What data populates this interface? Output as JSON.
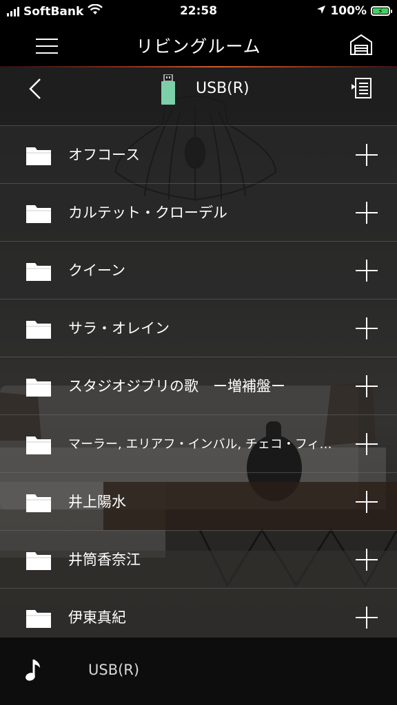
{
  "status_bar": {
    "carrier": "SoftBank",
    "time": "22:58",
    "battery": "100%",
    "icons": [
      "signal-icon",
      "wifi-icon",
      "location-icon",
      "battery-charging-icon"
    ]
  },
  "header": {
    "title": "リビングルーム",
    "menu_icon": "menu-icon",
    "home_icon": "home-icon"
  },
  "subheader": {
    "source": "USB(R)",
    "back_icon": "back-icon",
    "source_icon": "usb-drive-icon",
    "queue_icon": "playlist-icon"
  },
  "folders": [
    {
      "label": "オフコース"
    },
    {
      "label": "カルテット・クローデル"
    },
    {
      "label": "クイーン"
    },
    {
      "label": "サラ・オレイン"
    },
    {
      "label": "スタジオジブリの歌　ー増補盤ー"
    },
    {
      "label": "マーラー, エリアフ・インバル, チェコ・フィルハーモニー管弦楽団"
    },
    {
      "label": "井上陽水"
    },
    {
      "label": "井筒香奈江"
    },
    {
      "label": "伊東真紀"
    }
  ],
  "bottom_bar": {
    "now_source": "USB(R)",
    "icon": "music-note-icon"
  },
  "colors": {
    "header_accent": "#d25a2a",
    "usb_green": "#7ccfa8",
    "battery_green": "#44d062"
  }
}
